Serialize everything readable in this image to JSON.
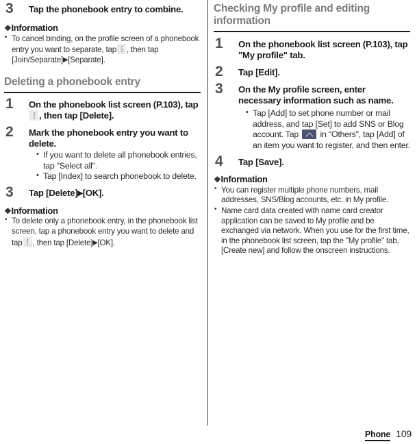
{
  "footer": {
    "chapter": "Phone",
    "page_number": "109"
  },
  "icons": {
    "overflow_menu": "overflow-menu-icon",
    "chevron_up": "chevron-up-icon",
    "triangle_right": "▶",
    "information_marker": "❖"
  },
  "left_column": {
    "step3_top": {
      "number": "3",
      "title": "Tap the phonebook entry to combine."
    },
    "information_top": {
      "heading": "Information",
      "items": [
        {
          "part1": "To cancel binding, on the profile screen of a phonebook entry you want to separate, tap",
          "part2": ", then tap [Join/Separate]",
          "part3": "[Separate]."
        }
      ]
    },
    "section": {
      "heading": "Deleting a phonebook entry"
    },
    "steps": [
      {
        "number": "1",
        "title_part1": "On the phonebook list screen (P.103), tap",
        "title_part2": ", then tap [Delete]."
      },
      {
        "number": "2",
        "title": "Mark the phonebook entry you want to delete.",
        "bullets": [
          "If you want to delete all phonebook entries, tap \"Select all\".",
          "Tap [Index] to search phonebook to delete."
        ]
      },
      {
        "number": "3",
        "title_a": "Tap [Delete]",
        "title_b": "[OK]."
      }
    ],
    "information_bottom": {
      "heading": "Information",
      "items": [
        {
          "part1": "To delete only a phonebook entry, in the phonebook list screen, tap a phonebook entry you want to delete and tap",
          "part2": ", then tap [Delete]",
          "part3": "[OK]."
        }
      ]
    }
  },
  "right_column": {
    "section": {
      "heading": "Checking My profile and editing information"
    },
    "steps": [
      {
        "number": "1",
        "title": "On the phonebook list screen (P.103), tap \"My profile\" tab."
      },
      {
        "number": "2",
        "title": "Tap [Edit]."
      },
      {
        "number": "3",
        "title": "On the My profile screen, enter necessary information such as name.",
        "bullet_part1": "Tap [Add] to set phone number or mail address, and tap [Set] to add SNS or Blog account. Tap",
        "bullet_part2": "in \"Others\", tap [Add] of an item you want to register, and then enter."
      },
      {
        "number": "4",
        "title": "Tap [Save]."
      }
    ],
    "information": {
      "heading": "Information",
      "items": [
        "You can register multiple phone numbers, mail addresses, SNS/Blog accounts, etc. in My profile.",
        "Name card data created with name card creator application can be saved to My profile and be exchanged via network. When you use for the first time, in the phonebook list screen, tap the \"My profile\" tab, [Create new] and follow the onscreen instructions."
      ]
    }
  }
}
